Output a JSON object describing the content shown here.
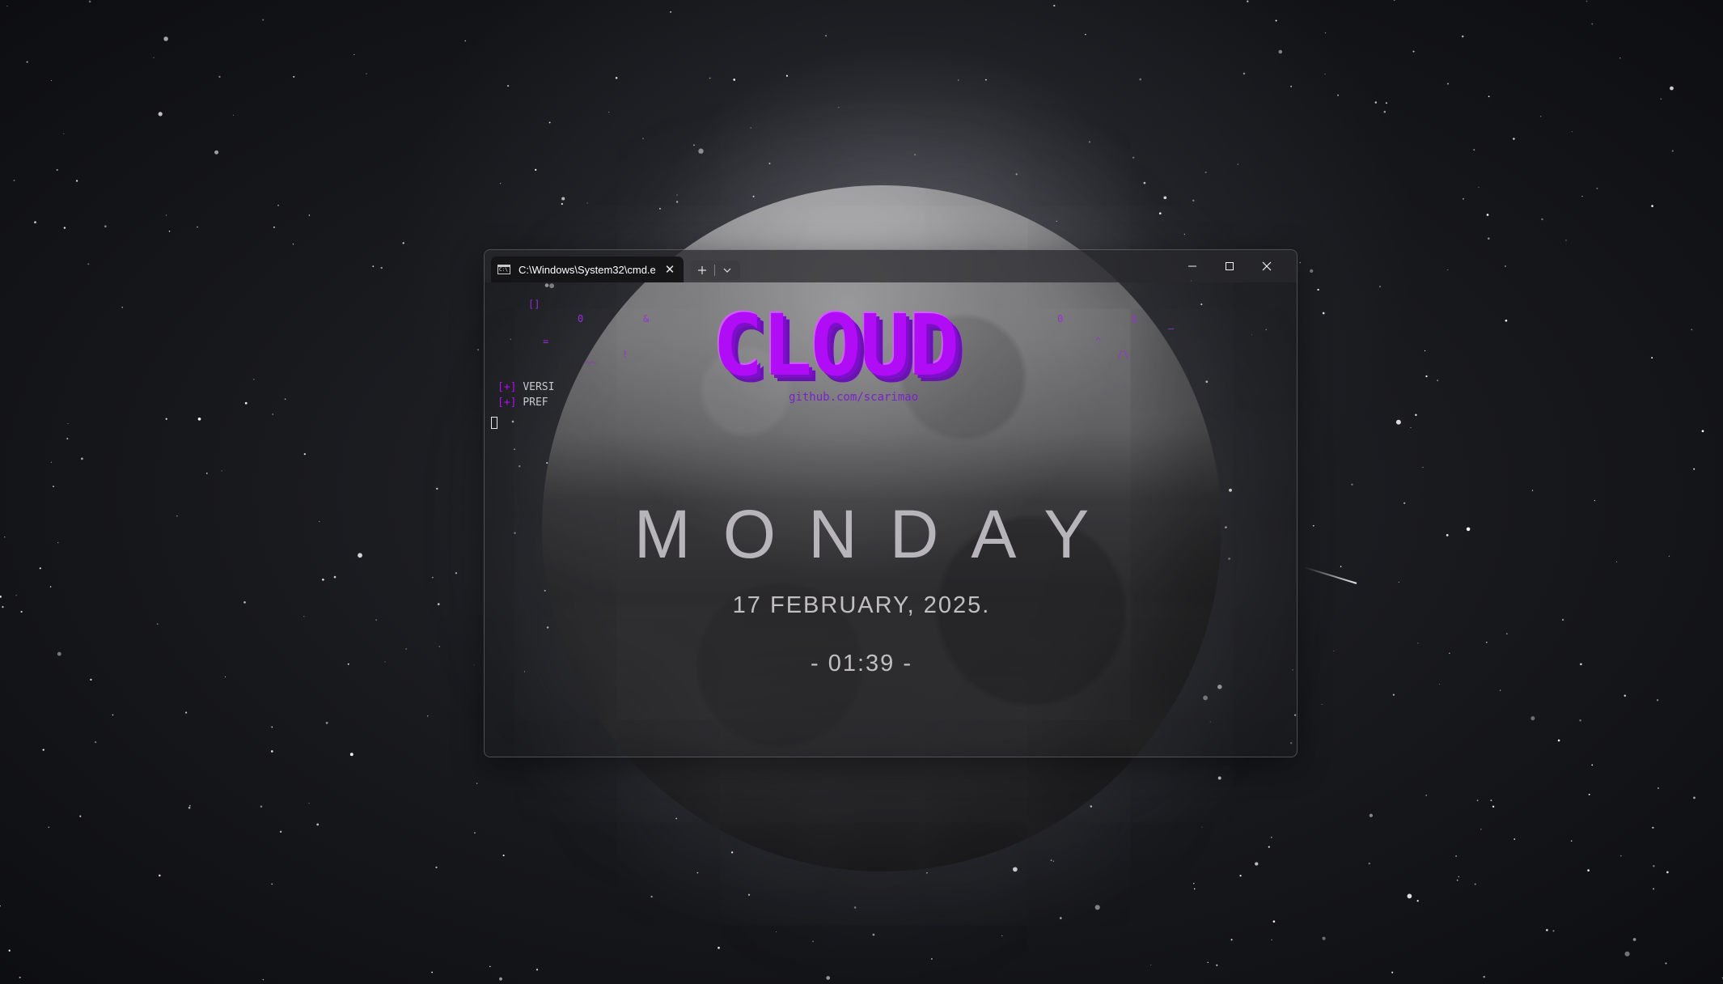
{
  "terminal": {
    "tab_title": "C:\\Windows\\System32\\cmd.e",
    "tab_icon": "cmd-icon",
    "new_tab_label": "+",
    "dropdown_label": "⌄",
    "close_tab_label": "✕",
    "minimize_label": "—",
    "maximize_label": "☐",
    "close_label": "✕",
    "logo": "CLOUD",
    "link": "github.com/scarimao",
    "status_lines": [
      {
        "prefix": "[+]",
        "text": "VERSI"
      },
      {
        "prefix": "[+]",
        "text": "PREF"
      }
    ],
    "scatter_glyphs": [
      "[]",
      "0",
      "&",
      "0",
      "$",
      "=",
      "^",
      "!",
      "/\\",
      "~~",
      "—"
    ]
  },
  "widget": {
    "day": "MONDAY",
    "date": "17  FEBRUARY,  2025.",
    "time": "- 01:39 -"
  },
  "colors": {
    "logo_purple": "#b00cf5",
    "link_purple": "#7a22c9",
    "widget_text": "#d9d6dc"
  }
}
